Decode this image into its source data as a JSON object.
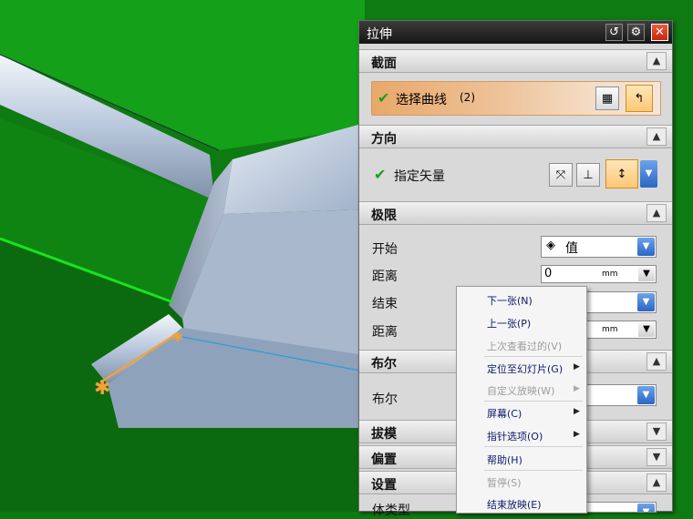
{
  "dialog": {
    "title": "拉伸",
    "title_buttons": {
      "reset": "↺",
      "settings": "⚙",
      "close": "✕"
    },
    "sections": {
      "section_curve": {
        "title": "截面",
        "row_label": "选择曲线",
        "row_count": "(2)"
      },
      "direction": {
        "title": "方向",
        "row_label": "指定矢量"
      },
      "limits": {
        "title": "极限",
        "start_label": "开始",
        "start_value": "值",
        "distance_label": "距离",
        "distance_value": "0",
        "unit": "mm",
        "end_label": "结束",
        "end_distance_label": "距离",
        "end_unit": "mm"
      },
      "boolean": {
        "title": "布尔",
        "label": "布尔"
      },
      "draft": {
        "title": "拔模"
      },
      "offset": {
        "title": "偏置"
      },
      "settings": {
        "title": "设置",
        "partial_row": "体类型"
      }
    }
  },
  "context_menu": {
    "items": [
      {
        "label": "下一张(N)",
        "enabled": true
      },
      {
        "label": "上一张(P)",
        "enabled": true
      },
      {
        "label": "上次查看过的(V)",
        "enabled": false
      },
      {
        "label": "定位至幻灯片(G)",
        "enabled": true,
        "submenu": true
      },
      {
        "label": "自定义放映(W)",
        "enabled": false,
        "submenu": true
      },
      {
        "label": "屏幕(C)",
        "enabled": true,
        "submenu": true
      },
      {
        "label": "指针选项(O)",
        "enabled": true,
        "submenu": true
      },
      {
        "label": "帮助(H)",
        "enabled": true
      },
      {
        "label": "暂停(S)",
        "enabled": false
      },
      {
        "label": "结束放映(E)",
        "enabled": true
      }
    ]
  },
  "colors": {
    "model_green": "#0e7a12",
    "model_face": "#c6d1e2",
    "highlight_orange": "#f2a238",
    "titlebar": "#1e1e1e",
    "selection_row": "#e8a86a",
    "accent_check": "#1aa01a"
  }
}
